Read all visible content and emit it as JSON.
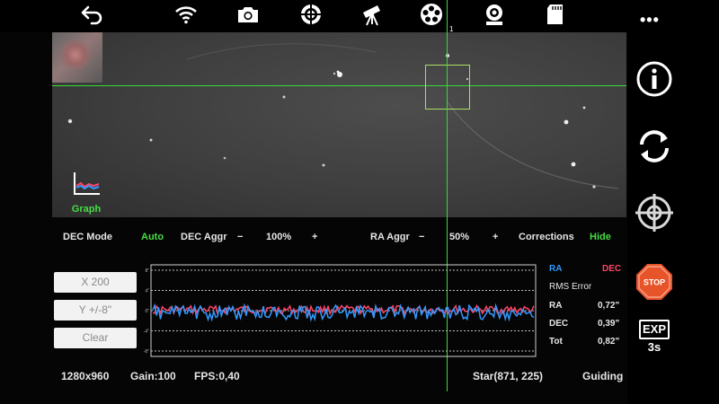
{
  "toolbar": {
    "icons": [
      "back-arrow-icon",
      "wifi-icon",
      "camera-icon",
      "focus-target-icon",
      "telescope-icon",
      "filter-wheel-icon",
      "webcam-icon",
      "sd-card-icon"
    ],
    "more_label": "•••"
  },
  "preview": {
    "graph_label": "Graph",
    "crosshair_label": "1"
  },
  "settings": {
    "dec_mode_label": "DEC Mode",
    "dec_mode_value": "Auto",
    "dec_aggr_label": "DEC Aggr",
    "dec_aggr_minus": "−",
    "dec_aggr_value": "100%",
    "dec_aggr_plus": "+",
    "ra_aggr_label": "RA Aggr",
    "ra_aggr_minus": "−",
    "ra_aggr_value": "50%",
    "ra_aggr_plus": "+",
    "corrections_label": "Corrections",
    "corrections_value": "Hide"
  },
  "controls": {
    "x_scale": "X 200",
    "y_scale": "Y +/-8\"",
    "clear": "Clear"
  },
  "graph": {
    "y_ticks": [
      "8\"",
      "4\"",
      "0\"",
      "-4\"",
      "-8\""
    ]
  },
  "rms": {
    "ra_legend": "RA",
    "dec_legend": "DEC",
    "title": "RMS Error",
    "ra_label": "RA",
    "ra_value": "0,72\"",
    "dec_label": "DEC",
    "dec_value": "0,39\"",
    "tot_label": "Tot",
    "tot_value": "0,82\""
  },
  "status": {
    "resolution": "1280x960",
    "gain": "Gain:100",
    "fps": "FPS:0,40",
    "star": "Star(871, 225)",
    "state": "Guiding"
  },
  "sidebar": {
    "icons": [
      "info-icon",
      "loop-icon",
      "crosshair-icon",
      "stop-icon"
    ],
    "stop_label": "STOP",
    "exp_label": "EXP",
    "exp_value": "3s"
  },
  "colors": {
    "ra": "#3399ff",
    "dec": "#ff4466",
    "accent_green": "#44dd44",
    "stop": "#e8542a"
  }
}
